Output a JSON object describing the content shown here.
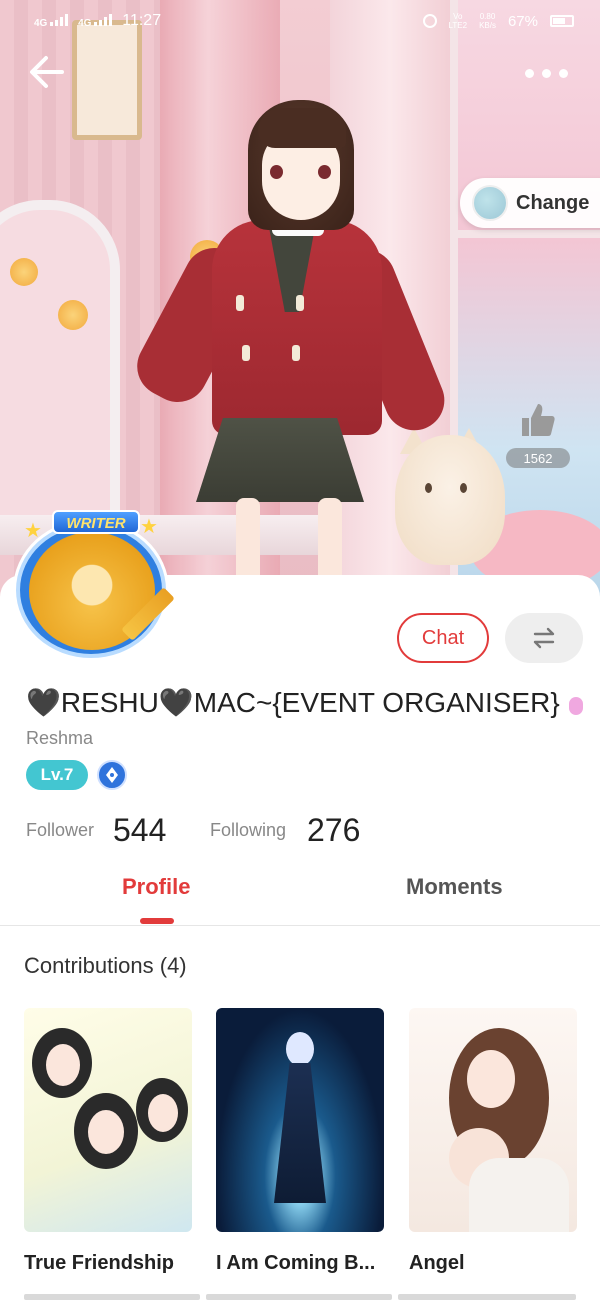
{
  "status_bar": {
    "network_1": "4G",
    "network_2": "4G",
    "time": "11:27",
    "volte_1": "Vo",
    "volte_2": "LTE2",
    "speed_value": "0.80",
    "speed_unit": "KB/s",
    "battery": "67%"
  },
  "header": {
    "change_label": "Change",
    "like_count": "1562"
  },
  "profile": {
    "badge": "WRITER",
    "chat_label": "Chat",
    "username": "🖤RESHU🖤MAC~{EVENT ORGANISER}",
    "real_name": "Reshma",
    "level": "Lv.7",
    "follower_label": "Follower",
    "follower_count": "544",
    "following_label": "Following",
    "following_count": "276"
  },
  "tabs": {
    "profile": "Profile",
    "moments": "Moments",
    "active": "profile"
  },
  "contributions": {
    "title": "Contributions (4)",
    "items": [
      {
        "title": "True Friendship"
      },
      {
        "title": "I Am Coming B..."
      },
      {
        "title": "Angel"
      }
    ]
  },
  "colors": {
    "accent": "#e23b3b",
    "level_badge": "#43c6d1",
    "creator_badge": "#2f73dc"
  },
  "icons": {
    "back": "arrow-left-icon",
    "more": "more-dots-icon",
    "like": "thumbs-up-icon",
    "switch": "swap-arrows-icon",
    "creator": "creator-badge-icon"
  }
}
